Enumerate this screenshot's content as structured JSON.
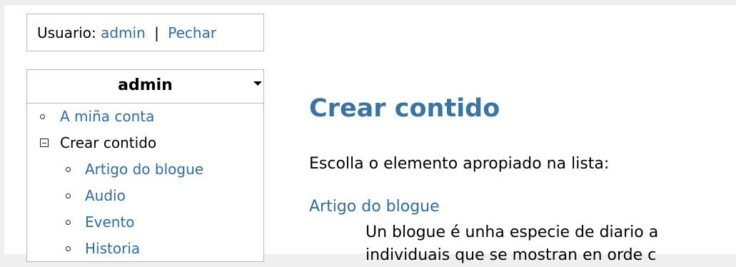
{
  "user": {
    "prefix": "Usuario:",
    "name": "admin",
    "separator": "|",
    "logout": "Pechar"
  },
  "menu": {
    "title": "admin",
    "items": [
      {
        "label": "A miña conta"
      },
      {
        "label": "Crear contido"
      },
      {
        "label": "Artigo do blogue"
      },
      {
        "label": "Audio"
      },
      {
        "label": "Evento"
      },
      {
        "label": "Historia"
      }
    ]
  },
  "content": {
    "title": "Crear contido",
    "intro": "Escolla o elemento apropiado na lista:",
    "item_title": "Artigo do blogue",
    "item_desc_line1": "Un blogue é unha especie de diario a",
    "item_desc_line2": "individuais que se mostran en orde c"
  },
  "colors": {
    "link": "#2e6bab",
    "heading": "#3a73a6"
  }
}
